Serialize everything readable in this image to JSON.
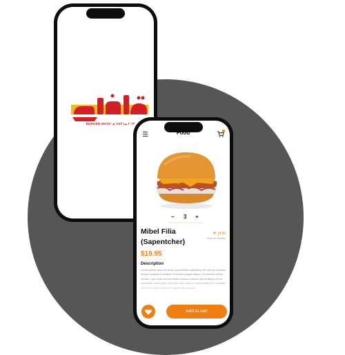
{
  "splash": {
    "logo_arabic": "واقف",
    "caption": "BURGER WAGF  ٢٠٢٢ منذ ١٤٤٣ هـ"
  },
  "product_screen": {
    "header_title": "Food",
    "quantity": "3",
    "quantity_minus": "−",
    "quantity_plus": "+",
    "product_name": "Mibel Filia (Sapentcher)",
    "rating": "(4.8)",
    "reviews_link": "View all reviews",
    "price": "$19.95",
    "description_title": "Description",
    "description_text": "Lorem ipsum dolor sit amet, consectetur adipiscing elit, sed do eiusmod tempor incididunt ut labore et dolore magna aliqua. Ut enim ad minim veniam, quis nostrud exercitation ullamco laboris nisi ut aliquip ex ea commodo consequat. Duis aute irure dolor in reprehenderit in voluptate velit esse cillum dolore eu fugiat nulla pariatur.",
    "add_to_cart_label": "Add to cart",
    "icons": [
      "menu-icon",
      "cart-icon",
      "star-icon",
      "heart-icon"
    ],
    "accent_color": "#f07f13"
  },
  "background_circle_color": "#555757"
}
